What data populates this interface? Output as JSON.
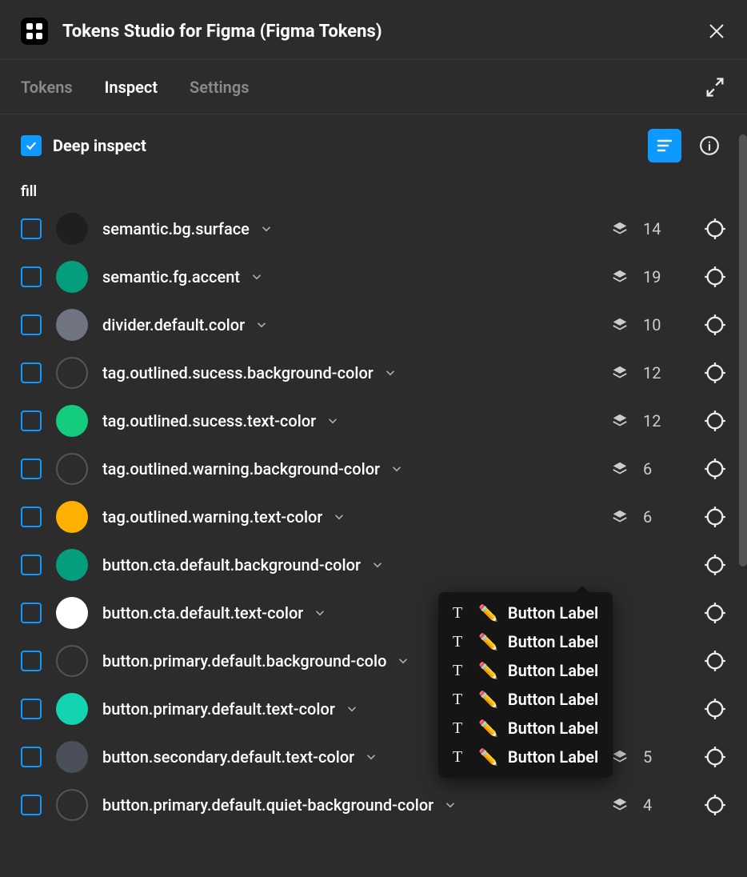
{
  "header": {
    "title": "Tokens Studio for Figma (Figma Tokens)"
  },
  "tabs": [
    {
      "label": "Tokens",
      "active": false
    },
    {
      "label": "Inspect",
      "active": true
    },
    {
      "label": "Settings",
      "active": false
    }
  ],
  "toolbar": {
    "deep_inspect_label": "Deep inspect",
    "deep_inspect_checked": true
  },
  "section": "fill",
  "rows": [
    {
      "token": "semantic.bg.surface",
      "swatch": "#1f1f1f",
      "outlined": false,
      "count": "14"
    },
    {
      "token": "semantic.fg.accent",
      "swatch": "#059e7c",
      "outlined": false,
      "count": "19"
    },
    {
      "token": "divider.default.color",
      "swatch": "#6f7480",
      "outlined": false,
      "count": "10"
    },
    {
      "token": "tag.outlined.sucess.background-color",
      "swatch": "",
      "outlined": true,
      "count": "12"
    },
    {
      "token": "tag.outlined.sucess.text-color",
      "swatch": "#14cc7e",
      "outlined": false,
      "count": "12"
    },
    {
      "token": "tag.outlined.warning.background-color",
      "swatch": "",
      "outlined": true,
      "count": "6"
    },
    {
      "token": "tag.outlined.warning.text-color",
      "swatch": "#ffb000",
      "outlined": false,
      "count": "6"
    },
    {
      "token": "button.cta.default.background-color",
      "swatch": "#059e7c",
      "outlined": false,
      "count": ""
    },
    {
      "token": "button.cta.default.text-color",
      "swatch": "#ffffff",
      "outlined": false,
      "count": ""
    },
    {
      "token": "button.primary.default.background-color",
      "swatch": "",
      "outlined": true,
      "count": "",
      "truncated": "button.primary.default.background-colo"
    },
    {
      "token": "button.primary.default.text-color",
      "swatch": "#14d3b0",
      "outlined": false,
      "count": ""
    },
    {
      "token": "button.secondary.default.text-color",
      "swatch": "#4b4f5a",
      "outlined": false,
      "count": "5"
    },
    {
      "token": "button.primary.default.quiet-background-color",
      "swatch": "",
      "outlined": true,
      "count": "4"
    }
  ],
  "popover": {
    "items": [
      {
        "label": "Button Label"
      },
      {
        "label": "Button Label"
      },
      {
        "label": "Button Label"
      },
      {
        "label": "Button Label"
      },
      {
        "label": "Button Label"
      },
      {
        "label": "Button Label"
      }
    ]
  },
  "icons": {
    "close": "close-icon",
    "collapse": "collapse-icon",
    "format": "format-icon",
    "info": "info-icon",
    "layers": "layers-icon",
    "target": "target-icon",
    "chevron": "chevron-down-icon",
    "pencil": "✏️",
    "text_t": "T"
  }
}
